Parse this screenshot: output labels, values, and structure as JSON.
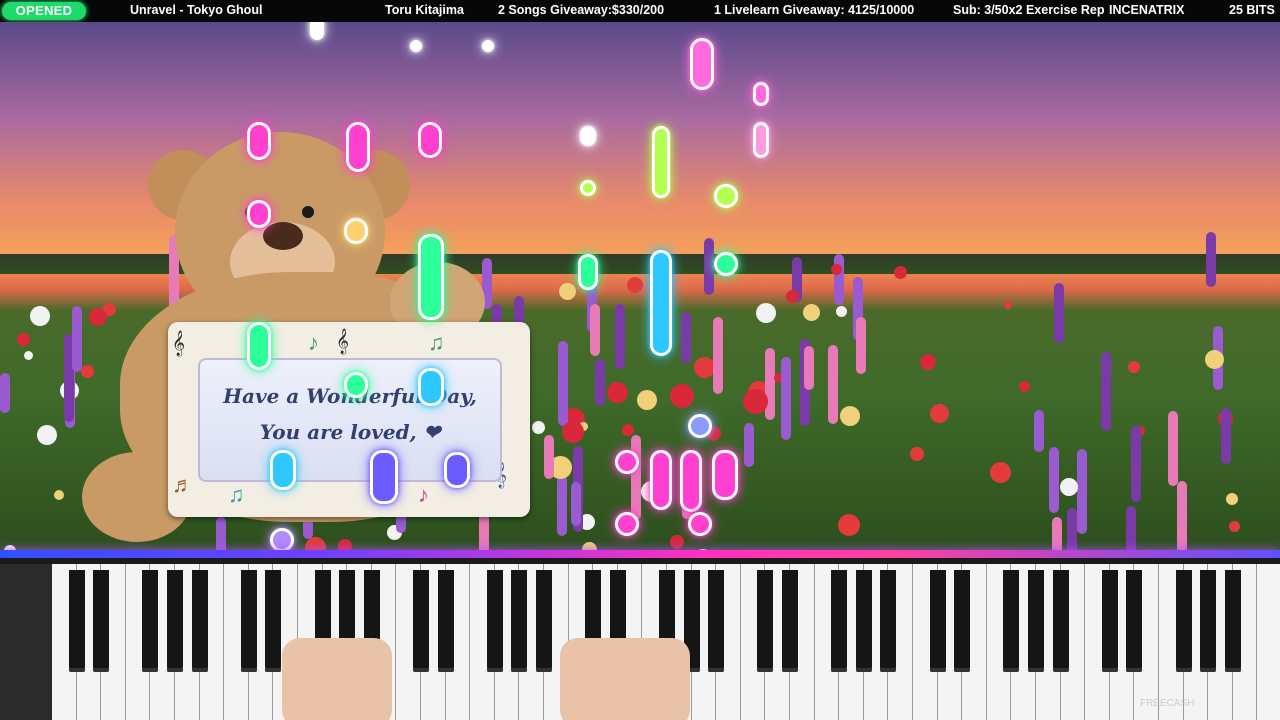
{
  "status_bar": {
    "badge": "OPENED",
    "song": "Unravel - Tokyo Ghoul",
    "artist": "Toru Kitajima",
    "songs_giveaway": "2 Songs Giveaway:$330/200",
    "livelearn_giveaway": "1 Livelearn Giveaway: 4125/10000",
    "sub_goal": "Sub: 3/50x2 Exercise Rep",
    "username": "INCENATRIX",
    "bits": "25 BITS",
    "colors": {
      "badge": "#1fd96a",
      "bar": "#070707"
    }
  },
  "sign": {
    "line1": "Have a Wonderful Day,",
    "line2": "You are loved, ❤"
  },
  "keyboard": {
    "watermark": "FREECASH"
  },
  "notes_colors": [
    "#ff40d0",
    "#ffffff",
    "#b5ff50",
    "#2cff9a",
    "#2cc8ff",
    "#6a5cff"
  ]
}
